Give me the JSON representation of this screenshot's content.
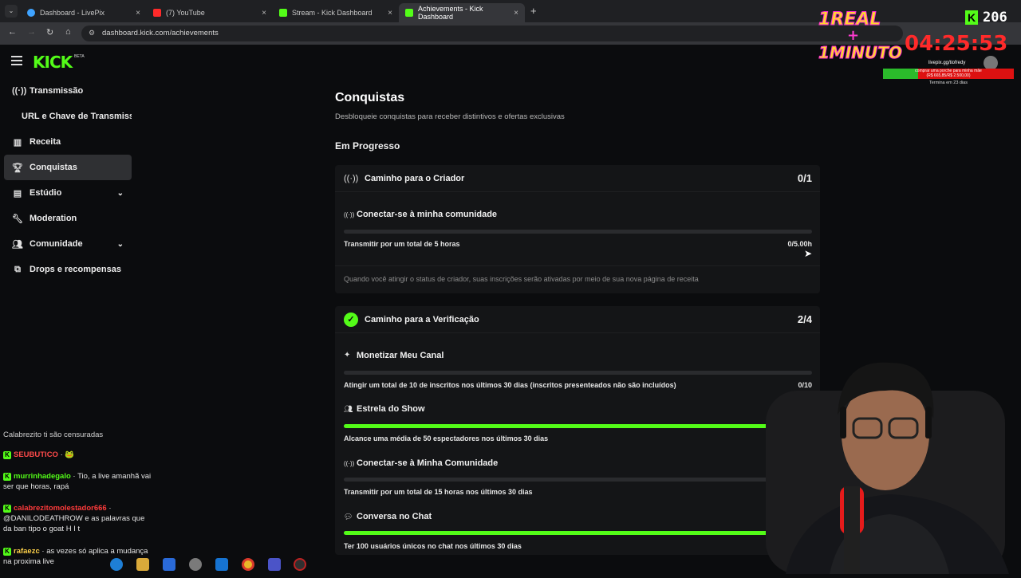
{
  "browser": {
    "tabs": [
      {
        "label": "Dashboard - LivePix",
        "color": "#3fa3ff"
      },
      {
        "label": "(7) YouTube",
        "color": "#ff2a2a"
      },
      {
        "label": "Stream - Kick Dashboard",
        "color": "#53fc18"
      },
      {
        "label": "Achievements - Kick Dashboard",
        "color": "#53fc18"
      }
    ],
    "close_glyph": "×",
    "new_tab_glyph": "+",
    "url": "dashboard.kick.com/achievements"
  },
  "brand": {
    "logo_text": "KICK",
    "beta": "BETA",
    "accent": "#53fc18"
  },
  "sidebar": {
    "items": [
      {
        "label": "Transmissão",
        "icon": "broadcast-icon"
      },
      {
        "label": "URL e Chave de Transmissã",
        "icon": ""
      },
      {
        "label": "Receita",
        "icon": "chart-icon"
      },
      {
        "label": "Conquistas",
        "icon": "trophy-icon"
      },
      {
        "label": "Estúdio",
        "icon": "layout-icon"
      },
      {
        "label": "Moderation",
        "icon": "wrench-icon"
      },
      {
        "label": "Comunidade",
        "icon": "users-icon"
      },
      {
        "label": "Drops e recompensas",
        "icon": "drops-icon"
      }
    ]
  },
  "page": {
    "title": "Conquistas",
    "subtitle": "Desbloqueie conquistas para receber distintivos e ofertas exclusivas",
    "section": "Em Progresso"
  },
  "card1": {
    "title": "Caminho para o Criador",
    "count": "0/1",
    "task_title": "Conectar-se à minha comunidade",
    "task_desc": "Transmitir por um total de 5 horas",
    "task_value": "0/5.00h",
    "task_progress": 0,
    "note": "Quando você atingir o status de criador, suas inscrições serão ativadas por meio de sua nova página de receita"
  },
  "card2": {
    "title": "Caminho para a Verificação",
    "count": "2/4",
    "tasks": [
      {
        "title": "Monetizar Meu Canal",
        "desc": "Atingir um total de 10 de inscritos nos últimos 30 dias (inscritos presenteados não são incluídos)",
        "value": "0/10",
        "progress": 0
      },
      {
        "title": "Estrela do Show",
        "desc": "Alcance uma média de 50 espectadores nos últimos 30 dias",
        "value": "",
        "progress": 1
      },
      {
        "title": "Conectar-se à Minha Comunidade",
        "desc": "Transmitir por um total de 15 horas nos últimos 30 dias",
        "value": "",
        "progress": 0
      },
      {
        "title": "Conversa no Chat",
        "desc": "Ter 100 usuários únicos no chat nos últimos 30 dias",
        "value": "",
        "progress": 1
      }
    ]
  },
  "overlay": {
    "promo_line1": "1REAL",
    "promo_plus": "+",
    "promo_line2": "1MINUTO",
    "timer": "04:25:53",
    "viewers": "206",
    "livepix_url": "livepix.gg/tiofredy",
    "goal_text": "comprar uma porche para minha mãe",
    "goal_amount": "(R$ 665,85/R$ 2.500,00)",
    "goal_end": "Termina em 23 dias"
  },
  "chat": [
    {
      "user": "",
      "user_color": "#e5e5e5",
      "text": "Calabrezito ti são censuradas"
    },
    {
      "user": "SEUBUTICO",
      "user_color": "#ff4a4a",
      "text": "🐸"
    },
    {
      "user": "murrinhadegalo",
      "user_color": "#53fc18",
      "text": "Tio, a live amanhã vai ser que horas, rapá"
    },
    {
      "user": "calabrezitomolestador666",
      "user_color": "#ff3b3b",
      "text": "@DANILODEATHROW e as palavras que da ban tipo o goat H I t"
    },
    {
      "user": "rafaezc",
      "user_color": "#ffd24a",
      "text": "as vezes só aplica a mudança na proxima live"
    }
  ]
}
